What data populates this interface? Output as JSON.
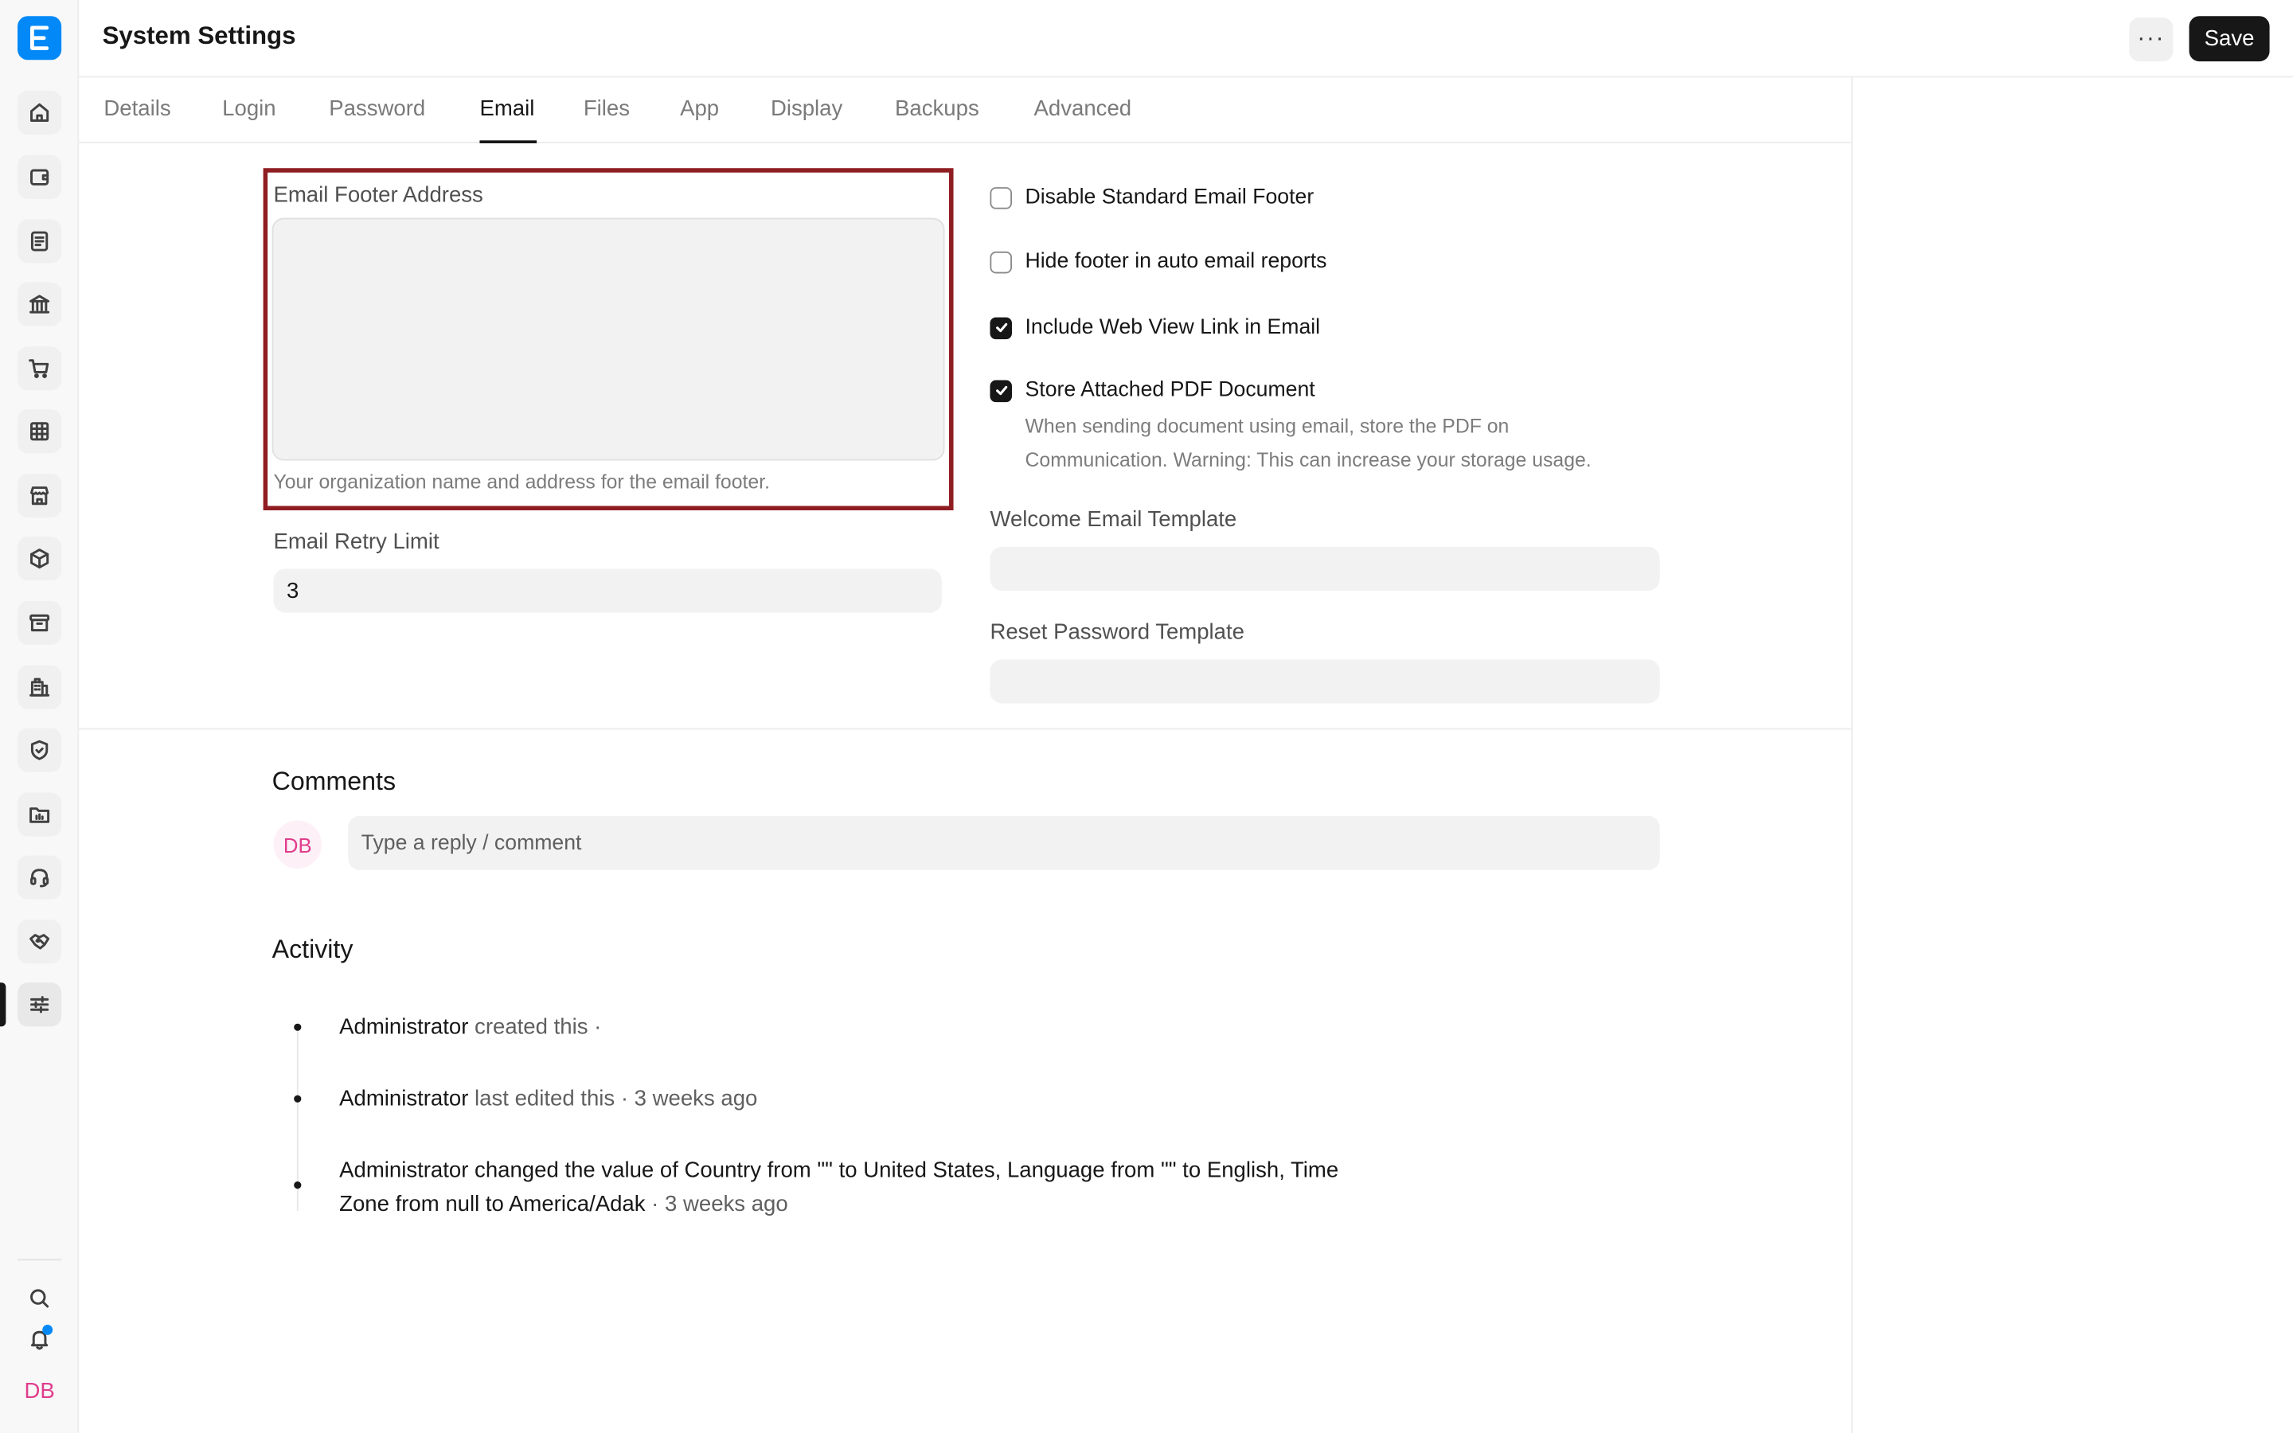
{
  "header": {
    "title": "System Settings",
    "more_label": "···",
    "save_label": "Save"
  },
  "sidebar": {
    "logo": "E",
    "items": [
      {
        "name": "home-icon"
      },
      {
        "name": "wallet-icon"
      },
      {
        "name": "file-text-icon"
      },
      {
        "name": "bank-icon"
      },
      {
        "name": "cart-icon"
      },
      {
        "name": "table-icon"
      },
      {
        "name": "store-icon"
      },
      {
        "name": "package-icon"
      },
      {
        "name": "archive-icon"
      },
      {
        "name": "building-icon"
      },
      {
        "name": "shield-check-icon"
      },
      {
        "name": "folder-chart-icon"
      },
      {
        "name": "headset-icon"
      },
      {
        "name": "handshake-icon"
      },
      {
        "name": "sliders-icon",
        "active": true
      }
    ],
    "avatar_initials": "DB"
  },
  "tabs": [
    {
      "label": "Details"
    },
    {
      "label": "Login"
    },
    {
      "label": "Password"
    },
    {
      "label": "Email",
      "active": true
    },
    {
      "label": "Files"
    },
    {
      "label": "App"
    },
    {
      "label": "Display"
    },
    {
      "label": "Backups"
    },
    {
      "label": "Advanced"
    }
  ],
  "form": {
    "email_footer_address": {
      "label": "Email Footer Address",
      "value": "",
      "description": "Your organization name and address for the email footer."
    },
    "email_retry_limit": {
      "label": "Email Retry Limit",
      "value": "3"
    },
    "checkboxes": [
      {
        "label": "Disable Standard Email Footer",
        "checked": false
      },
      {
        "label": "Hide footer in auto email reports",
        "checked": false
      },
      {
        "label": "Include Web View Link in Email",
        "checked": true
      },
      {
        "label": "Store Attached PDF Document",
        "checked": true
      }
    ],
    "store_pdf_description_line1": "When sending document using email, store the PDF on",
    "store_pdf_description_line2": "Communication. Warning: This can increase your storage usage.",
    "welcome_email_template": {
      "label": "Welcome Email Template",
      "value": ""
    },
    "reset_password_template": {
      "label": "Reset Password Template",
      "value": ""
    }
  },
  "comments": {
    "title": "Comments",
    "avatar_initials": "DB",
    "placeholder": "Type a reply / comment"
  },
  "activity": {
    "title": "Activity",
    "items": [
      {
        "user": "Administrator",
        "text": " created this ·"
      },
      {
        "user": "Administrator",
        "text": " last edited this · 3 weeks ago"
      },
      {
        "p1": "Administrator changed the value of Country from \"\" to ",
        "v1": "United States",
        "p2": ", Language from \"\" to ",
        "v2": "English",
        "p3": ", Time",
        "p4": "Zone from ",
        "v3": "null",
        "p5": " to ",
        "v4": "America/Adak",
        "time": " · 3 weeks ago"
      }
    ]
  },
  "colors": {
    "brand": "#0289f7",
    "highlight_border": "#8f1d22",
    "primary_button": "#171717",
    "avatar_text": "#e03d8c"
  }
}
